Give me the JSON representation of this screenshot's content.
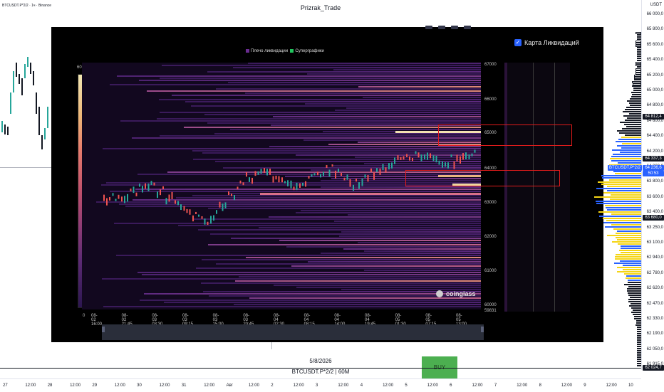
{
  "header": {
    "symbol": "BTCUSDT.P*2/2 · 1ч · Binance",
    "title": "Prizrak_Trade"
  },
  "price_axis": {
    "currency": "USDT",
    "labels": [
      "66 000,0",
      "65 800,0",
      "65 600,0",
      "65 400,0",
      "65 200,0",
      "65 000,0",
      "64 800,0",
      "64 600,0",
      "64 400,0",
      "64 200,0",
      "64 000,0",
      "63 800,0",
      "63 600,0",
      "63 400,0",
      "63 250,0",
      "63 100,0",
      "62 940,0",
      "62 780,0",
      "62 620,0",
      "62 470,0",
      "62 330,0",
      "62 190,0",
      "62 050,0",
      "61 915,0"
    ],
    "badges": [
      {
        "text": "64 812,4",
        "color": "#131722"
      },
      {
        "text": "64 337,3",
        "color": "#131722"
      },
      {
        "text": "BTCUSDT.P*2/2",
        "color": "#2962ff"
      },
      {
        "text": "64 236,6",
        "color": "#2962ff"
      },
      {
        "text": "50:53",
        "color": "#2962ff"
      },
      {
        "text": "63 680,0",
        "color": "#131722"
      },
      {
        "text": "62 024,7",
        "color": "#131722"
      }
    ]
  },
  "overlay": {
    "legend": [
      "Плечо ликвидации",
      "Суперграфики"
    ],
    "legend_colors": [
      "#6a2c91",
      "#22c55e"
    ],
    "liq_map_label": "Карта Ликвидаций",
    "colorbar_max": "60.02M",
    "colorbar_min": "0",
    "x_ticks": [
      "08-02 16:00",
      "08-02 21:45",
      "08-03 03:30",
      "08-03 09:15",
      "08-03 15:00",
      "08-03 20:45",
      "08-04 02:30",
      "08-04 08:15",
      "08-04 14:00",
      "08-04 19:45",
      "08-05 01:30",
      "08-05 07:15",
      "08-05 13:00"
    ],
    "y_ticks": [
      "67000",
      "66000",
      "65000",
      "64000",
      "63000",
      "62000",
      "61000",
      "60000",
      "59831"
    ],
    "watermark": "coinglass"
  },
  "bottom": {
    "date": "5/8/2026",
    "symbol_line": "BTCUSDT.P*2/2 | 60M",
    "buy_label": "BUY"
  },
  "time_axis": [
    "27",
    "12:00",
    "28",
    "12:00",
    "29",
    "12:00",
    "30",
    "12:00",
    "31",
    "12:00",
    "Авг",
    "12:00",
    "2",
    "12:00",
    "3",
    "12:00",
    "4",
    "12:00",
    "5",
    "12:00",
    "6",
    "12:00",
    "7",
    "12:00",
    "8",
    "12:00",
    "9",
    "12:00",
    "10"
  ]
}
